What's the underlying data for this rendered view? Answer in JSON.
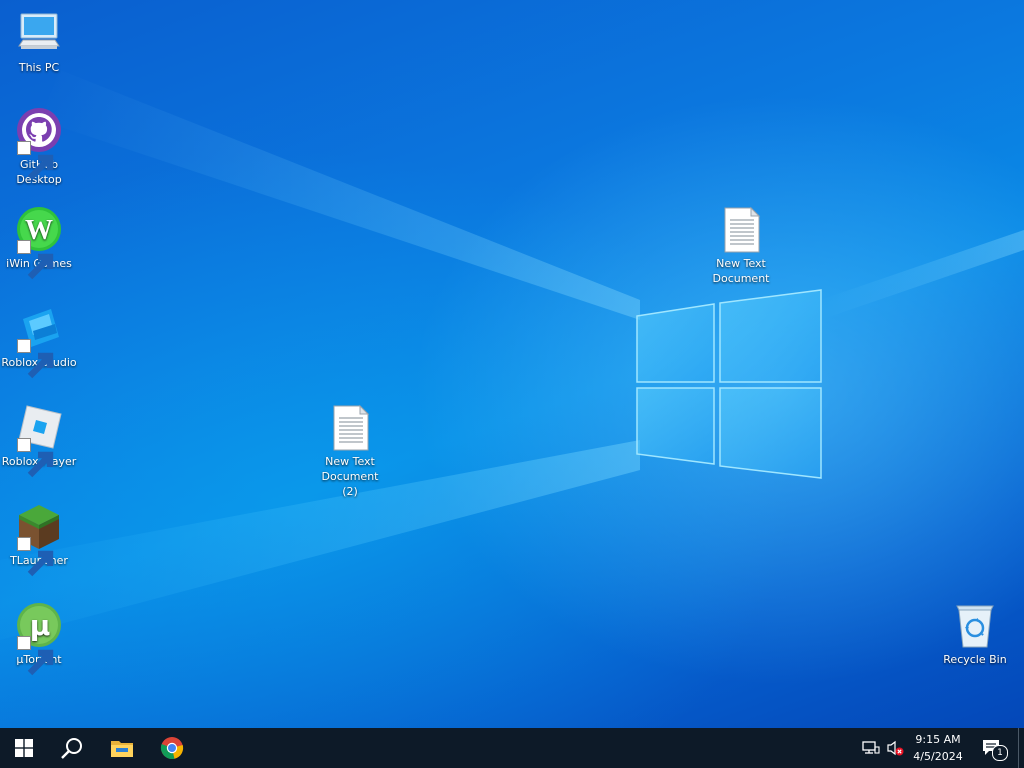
{
  "desktop": {
    "icons": [
      {
        "label": "This PC",
        "icon": "computer-icon"
      },
      {
        "label": "GitHub Desktop",
        "icon": "github-icon"
      },
      {
        "label": "iWin Games",
        "icon": "iwin-icon"
      },
      {
        "label": "Roblox Studio",
        "icon": "roblox-studio-icon"
      },
      {
        "label": "Roblox Player",
        "icon": "roblox-player-icon"
      },
      {
        "label": "TLauncher",
        "icon": "tlauncher-icon"
      },
      {
        "label": "µTorrent",
        "icon": "utorrent-icon"
      },
      {
        "label": "New Text Document",
        "icon": "text-document-icon"
      },
      {
        "label": "New Text Document (2)",
        "icon": "text-document-icon"
      },
      {
        "label": "Recycle Bin",
        "icon": "recycle-bin-icon"
      }
    ]
  },
  "taskbar": {
    "start": "windows-logo-icon",
    "search": "search-icon",
    "pinned": [
      "file-explorer-icon",
      "chrome-icon"
    ],
    "tray": [
      "network-icon",
      "volume-muted-icon"
    ],
    "time": "9:15 AM",
    "date": "4/5/2024",
    "notification_count": "1"
  },
  "colors": {
    "taskbar": "#0d1a28",
    "wallpaper_accent": "#0a78df"
  }
}
